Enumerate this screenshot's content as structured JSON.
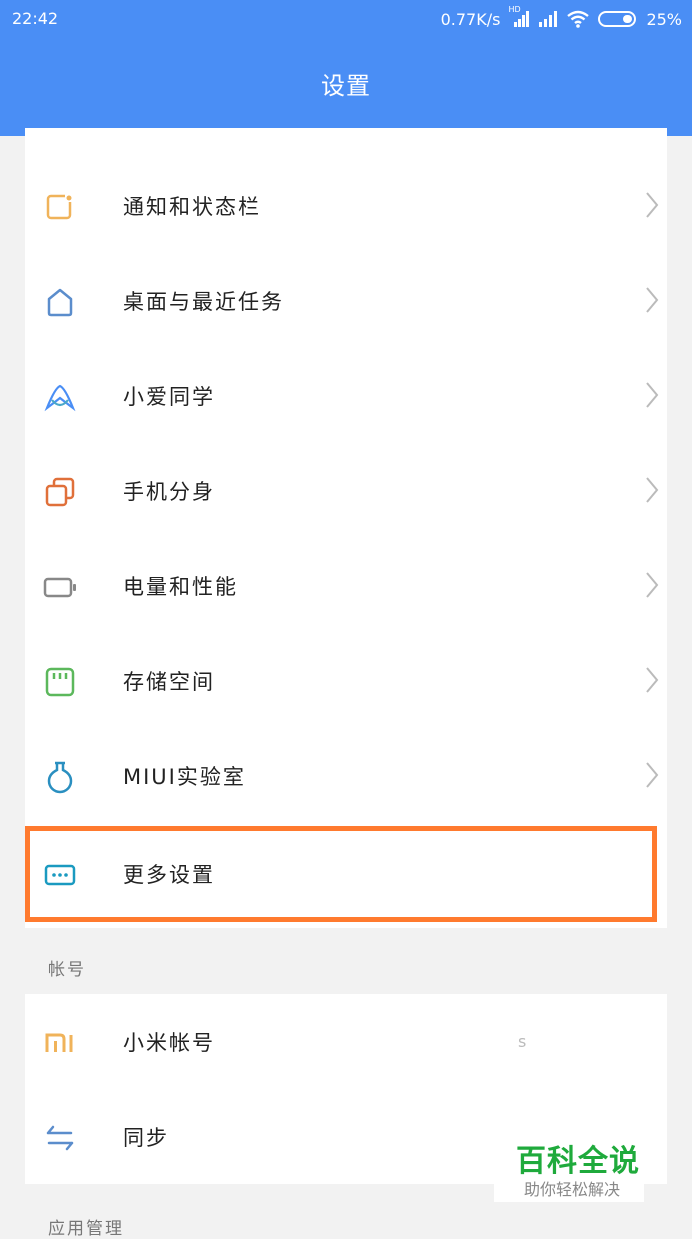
{
  "status_bar": {
    "time": "22:42",
    "network_speed": "0.77K/s",
    "hd_label": "HD",
    "battery": "25%"
  },
  "header": {
    "title": "设置"
  },
  "settings_items": [
    {
      "label": "通知和状态栏",
      "icon": "notification-icon",
      "color": "#f0b35a"
    },
    {
      "label": "桌面与最近任务",
      "icon": "home-icon",
      "color": "#5b8dcc"
    },
    {
      "label": "小爱同学",
      "icon": "xiaoai-icon",
      "color": "#4a8ef5"
    },
    {
      "label": "手机分身",
      "icon": "dual-phone-icon",
      "color": "#e0703a"
    },
    {
      "label": "电量和性能",
      "icon": "battery-icon",
      "color": "#888888"
    },
    {
      "label": "存储空间",
      "icon": "storage-icon",
      "color": "#5cb85c"
    },
    {
      "label": "MIUI实验室",
      "icon": "lab-flask-icon",
      "color": "#2a8fc0"
    },
    {
      "label": "更多设置",
      "icon": "more-settings-icon",
      "color": "#1a9ac0"
    }
  ],
  "highlight_color": "#ff7a2e",
  "account_section": {
    "title": "帐号",
    "items": [
      {
        "label": "小米帐号",
        "icon": "mi-logo-icon",
        "color": "#f0b35a"
      },
      {
        "label": "同步",
        "icon": "sync-icon",
        "color": "#5b8dcc"
      }
    ]
  },
  "apps_section": {
    "title": "应用管理"
  },
  "watermark": {
    "main": "百科全说",
    "sub": "助你轻松解决"
  },
  "stray_char": "s"
}
